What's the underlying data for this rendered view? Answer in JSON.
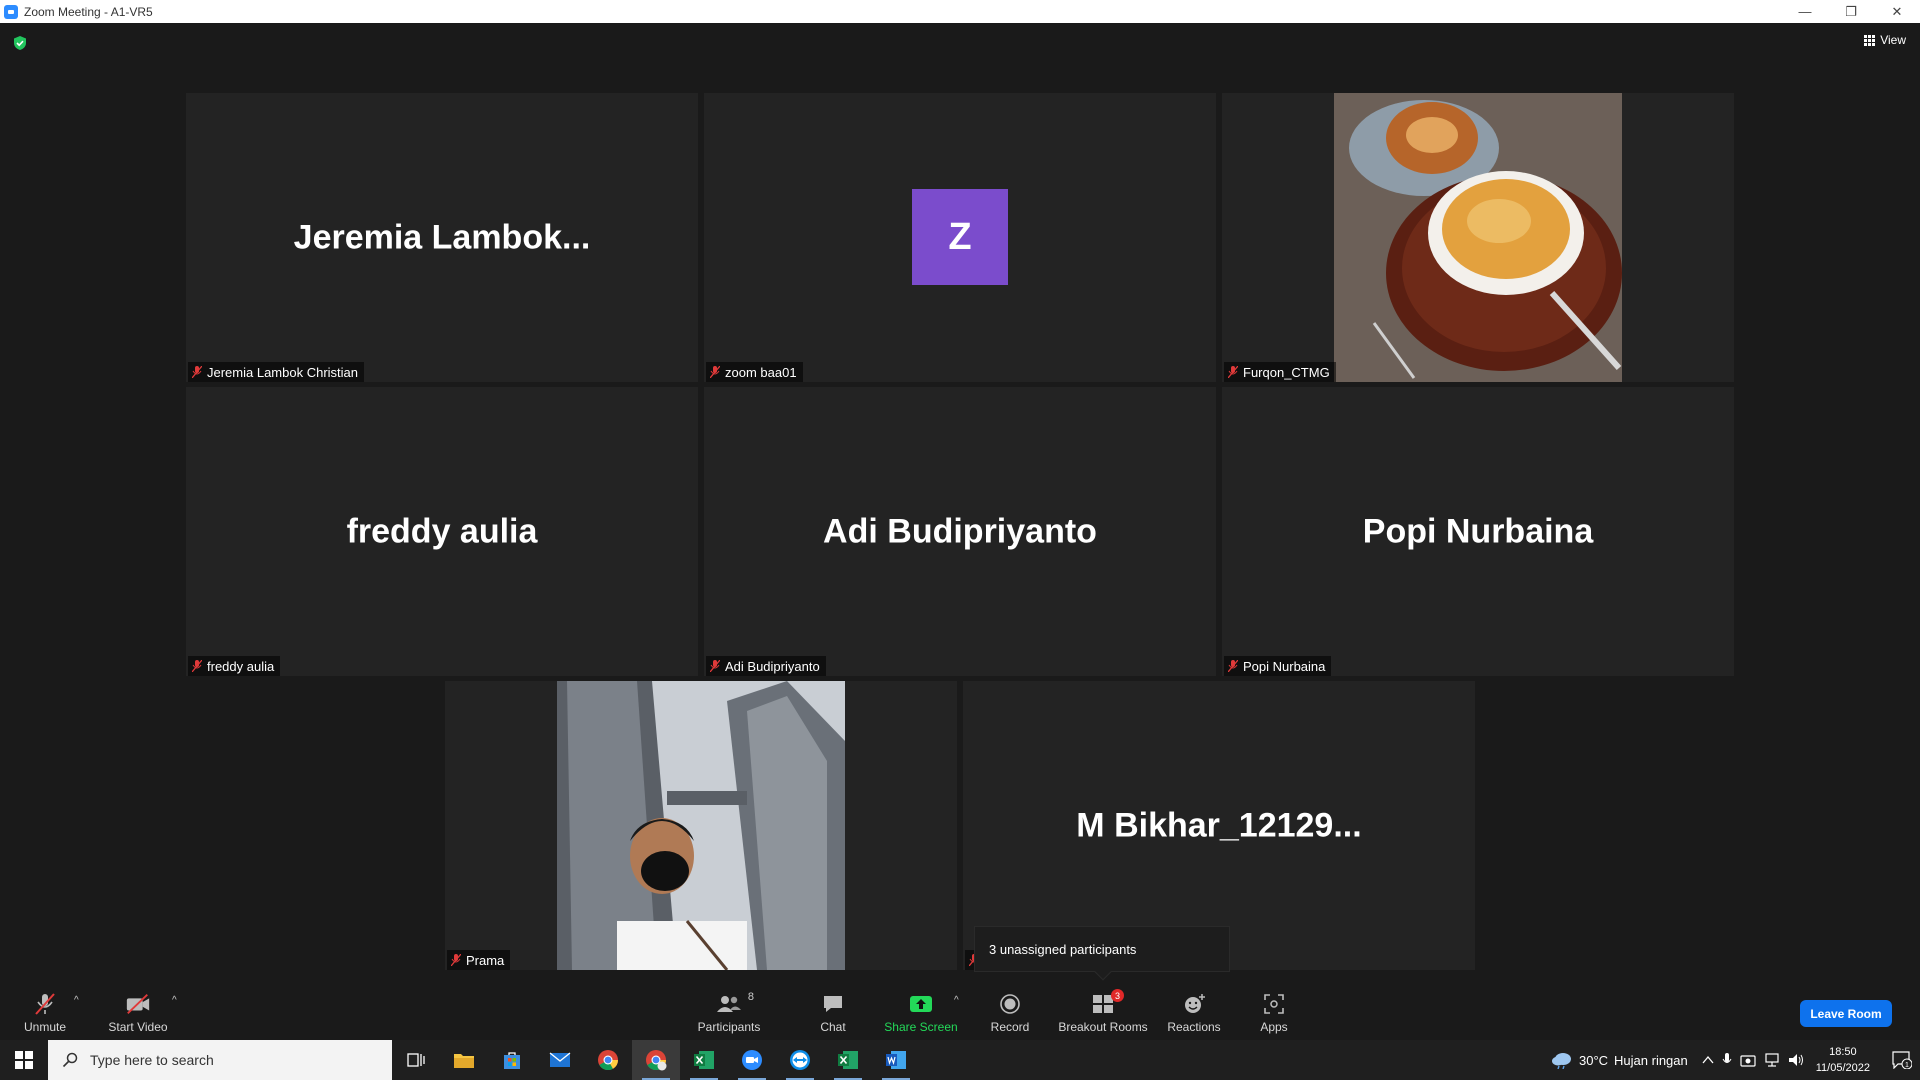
{
  "window": {
    "title": "Zoom Meeting - A1-VR5",
    "minimize": "—",
    "restore": "❐",
    "close": "✕"
  },
  "view_button": {
    "label": "View"
  },
  "tiles": [
    {
      "big_name": "Jeremia  Lambok...",
      "name_tag": "Jeremia Lambok Christian"
    },
    {
      "avatar_letter": "Z",
      "name_tag": "zoom baa01"
    },
    {
      "name_tag": "Furqon_CTMG"
    },
    {
      "big_name": "freddy aulia",
      "name_tag": "freddy aulia"
    },
    {
      "big_name": "Adi Budipriyanto",
      "name_tag": "Adi Budipriyanto"
    },
    {
      "big_name": "Popi Nurbaina",
      "name_tag": "Popi Nurbaina"
    },
    {
      "name_tag": "Prama"
    },
    {
      "big_name": "M  Bikhar_12129..."
    }
  ],
  "tooltip": {
    "text": "3 unassigned participants"
  },
  "toolbar": {
    "unmute": "Unmute",
    "start_video": "Start Video",
    "participants": "Participants",
    "participants_count": "8",
    "chat": "Chat",
    "share_screen": "Share Screen",
    "record": "Record",
    "breakout_rooms": "Breakout Rooms",
    "breakout_badge": "3",
    "reactions": "Reactions",
    "apps": "Apps",
    "leave_room": "Leave Room"
  },
  "taskbar": {
    "search_placeholder": "Type here to search",
    "weather_temp": "30°C",
    "weather_desc": "Hujan ringan",
    "time": "18:50",
    "date": "11/05/2022",
    "notification_count": "1"
  },
  "colors": {
    "leave_button": "#0e72ed",
    "share_screen_green": "#23d959",
    "avatar_purple": "#7b4ccc",
    "badge_red": "#e02828"
  }
}
